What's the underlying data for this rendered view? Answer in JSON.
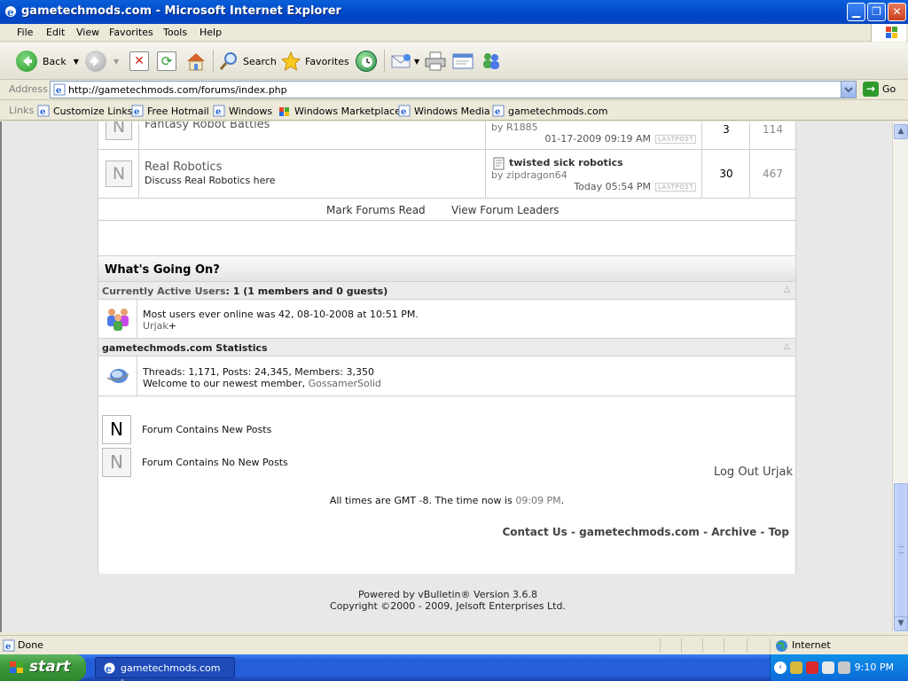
{
  "window": {
    "title": "gametechmods.com - Microsoft Internet Explorer"
  },
  "menu": [
    "File",
    "Edit",
    "View",
    "Favorites",
    "Tools",
    "Help"
  ],
  "toolbar": {
    "back_label": "Back",
    "search_label": "Search",
    "favorites_label": "Favorites"
  },
  "address": {
    "label": "Address",
    "url": "http://gametechmods.com/forums/index.php",
    "go_label": "Go"
  },
  "links": {
    "label": "Links",
    "items": [
      "Customize Links",
      "Free Hotmail",
      "Windows",
      "Windows Marketplace",
      "Windows Media",
      "gametechmods.com"
    ]
  },
  "forums": [
    {
      "title": "Fantasy Robot Battles",
      "last_by_prefix": "by",
      "last_by_user": "R1885",
      "last_date": "01-17-2009",
      "last_time": "09:19 AM",
      "threads": "3",
      "posts": "114"
    },
    {
      "title": "Real Robotics",
      "description": "Discuss Real Robotics here",
      "last_thread": "twisted sick robotics",
      "last_by_prefix": "by",
      "last_by_user": "zipdragon64",
      "last_date": "Today",
      "last_time": "05:54 PM",
      "threads": "30",
      "posts": "467"
    }
  ],
  "lastpost_label": "LASTPOST",
  "sub_links": {
    "mark_read": "Mark Forums Read",
    "forum_leaders": "View Forum Leaders"
  },
  "whats_going_on": {
    "title": "What's Going On?",
    "active_users_label": "Currently Active Users",
    "active_users_value": ": 1 (1 members and 0 guests)",
    "most_users_text": "Most users ever online was 42, 08-10-2008 at 10:51 PM.",
    "online_user": "Urjak",
    "online_user_suffix": "+",
    "stats_label": "gametechmods.com Statistics",
    "stats_text": "Threads: 1,171, Posts: 24,345, Members: 3,350",
    "welcome_text": "Welcome to our newest member,",
    "newest_member": "GossamerSolid"
  },
  "legend": {
    "icon_letter": "N",
    "new_posts": "Forum Contains New Posts",
    "no_new_posts": "Forum Contains No New Posts"
  },
  "logout_label": "Log Out Urjak",
  "time": {
    "prefix": "All times are GMT -8. The time now is",
    "value": "09:09 PM",
    "suffix": "."
  },
  "footer_links": {
    "contact": "Contact Us",
    "site": "gametechmods.com",
    "archive": "Archive",
    "top": "Top",
    "separator": "-"
  },
  "powered": {
    "line1": "Powered by vBulletin® Version 3.6.8",
    "line2": "Copyright ©2000 - 2009, Jelsoft Enterprises Ltd."
  },
  "status": {
    "text": "Done",
    "zone": "Internet"
  },
  "taskbar": {
    "start_label": "start",
    "task_label": "gametechmods.com -...",
    "clock": "9:10 PM"
  },
  "colors": {
    "titlebar": "#0453cf",
    "taskbar": "#245edb",
    "start_button": "#3c9a3c"
  }
}
